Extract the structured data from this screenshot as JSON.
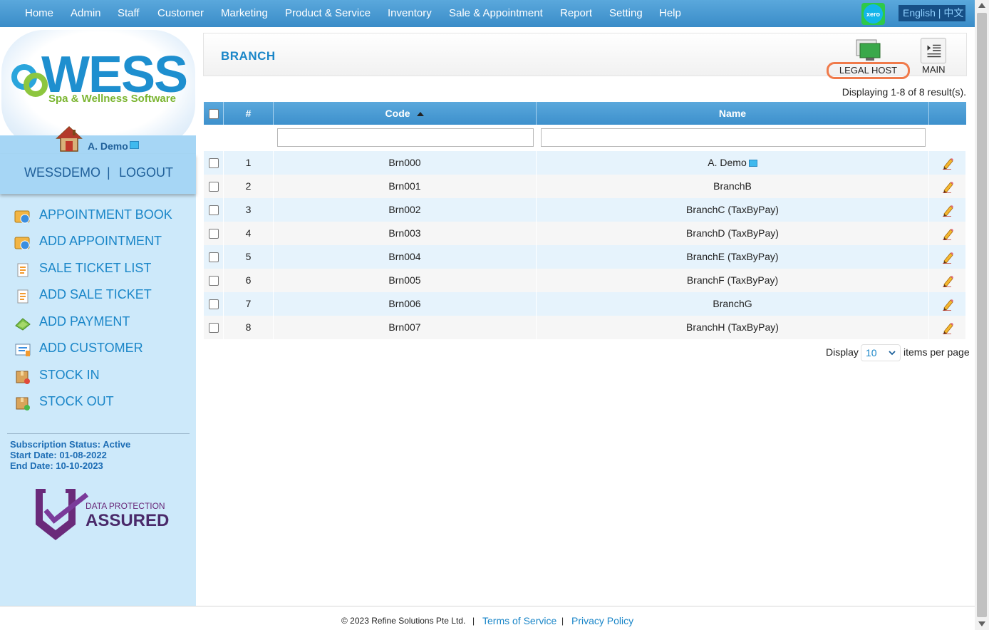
{
  "nav": {
    "items": [
      "Home",
      "Admin",
      "Staff",
      "Customer",
      "Marketing",
      "Product & Service",
      "Inventory",
      "Sale & Appointment",
      "Report",
      "Setting",
      "Help"
    ],
    "xero_label": "xero",
    "language": "English | 中文"
  },
  "sidebar": {
    "logo_text": "WESS",
    "logo_subtitle": "Spa & Wellness Software",
    "user_name": "A. Demo",
    "account": "WESSDEMO",
    "separator": "|",
    "logout": "LOGOUT",
    "menu": [
      {
        "label": "APPOINTMENT BOOK",
        "icon": "appointment-book-icon"
      },
      {
        "label": "ADD APPOINTMENT",
        "icon": "add-appointment-icon"
      },
      {
        "label": "SALE TICKET LIST",
        "icon": "sale-ticket-list-icon"
      },
      {
        "label": "ADD SALE TICKET",
        "icon": "add-sale-ticket-icon"
      },
      {
        "label": "ADD PAYMENT",
        "icon": "add-payment-icon"
      },
      {
        "label": "ADD CUSTOMER",
        "icon": "add-customer-icon"
      },
      {
        "label": "STOCK IN",
        "icon": "stock-in-icon"
      },
      {
        "label": "STOCK OUT",
        "icon": "stock-out-icon"
      }
    ],
    "subscription_status": "Subscription Status: Active",
    "start_date": "Start Date: 01-08-2022",
    "end_date": "End Date: 10-10-2023",
    "badge_line1": "DATA PROTECTION",
    "badge_line2": "ASSURED"
  },
  "header": {
    "title": "BRANCH",
    "legal_host_label": "LEGAL HOST",
    "main_label": "MAIN"
  },
  "table": {
    "display_info": "Displaying 1-8 of 8 result(s).",
    "columns": [
      "#",
      "Code",
      "Name"
    ],
    "rows": [
      {
        "num": "1",
        "code": "Brn000",
        "name": "A. Demo"
      },
      {
        "num": "2",
        "code": "Brn001",
        "name": "BranchB"
      },
      {
        "num": "3",
        "code": "Brn002",
        "name": "BranchC (TaxByPay)"
      },
      {
        "num": "4",
        "code": "Brn003",
        "name": "BranchD (TaxByPay)"
      },
      {
        "num": "5",
        "code": "Brn004",
        "name": "BranchE (TaxByPay)"
      },
      {
        "num": "6",
        "code": "Brn005",
        "name": "BranchF (TaxByPay)"
      },
      {
        "num": "7",
        "code": "Brn006",
        "name": "BranchG"
      },
      {
        "num": "8",
        "code": "Brn007",
        "name": "BranchH (TaxByPay)"
      }
    ]
  },
  "pager": {
    "display_label": "Display",
    "page_size": "10",
    "suffix": "items per page"
  },
  "footer": {
    "copyright": "© 2023 Refine Solutions Pte Ltd.",
    "sep": "|",
    "terms": "Terms of Service",
    "privacy": "Privacy Policy"
  },
  "colors": {
    "accent": "#1a86c8",
    "nav_bg": "#4a9dd6",
    "sidebar_bg": "#cde9fa",
    "legal_host_outline": "#f07a4a"
  }
}
